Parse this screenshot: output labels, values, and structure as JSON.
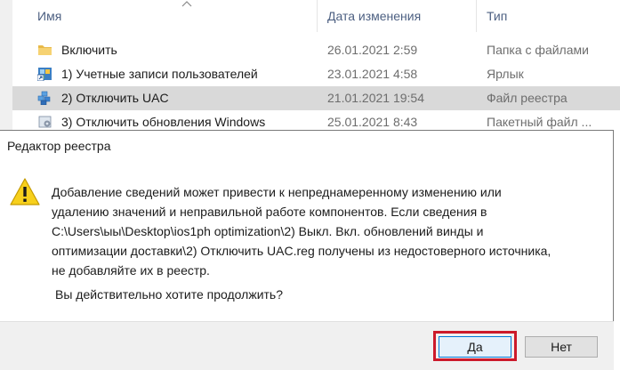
{
  "explorer": {
    "columns": {
      "name": "Имя",
      "date": "Дата изменения",
      "type": "Тип"
    },
    "sort_indicator": "^",
    "rows": [
      {
        "name": "Включить",
        "date": "26.01.2021 2:59",
        "type": "Папка с файлами",
        "icon": "folder-icon"
      },
      {
        "name": "1) Учетные записи пользователей",
        "date": "23.01.2021 4:58",
        "type": "Ярлык",
        "icon": "shortcut-icon"
      },
      {
        "name": "2) Отключить UAC",
        "date": "21.01.2021 19:54",
        "type": "Файл реестра",
        "icon": "registry-file-icon",
        "selected": true
      },
      {
        "name": "3) Отключить обновления Windows",
        "date": "25.01.2021 8:43",
        "type": "Пакетный файл ...",
        "icon": "batch-file-icon"
      }
    ]
  },
  "dialog": {
    "title": "Редактор реестра",
    "icon": "warning-icon",
    "message_lines": [
      "Добавление сведений может привести к непреднамеренному изменению или",
      "удалению значений и неправильной работе компонентов. Если сведения в",
      "C:\\Users\\ыы\\Desktop\\ios1ph optimization\\2) Выкл. Вкл. обновлений винды и",
      "оптимизации доставки\\2) Отключить UAC.reg получены из недостоверного источника,",
      "не добавляйте их в реестр."
    ],
    "question": "Вы действительно хотите продолжить?",
    "buttons": {
      "yes": "Да",
      "no": "Нет"
    },
    "highlight_color": "#cc1a2b"
  }
}
